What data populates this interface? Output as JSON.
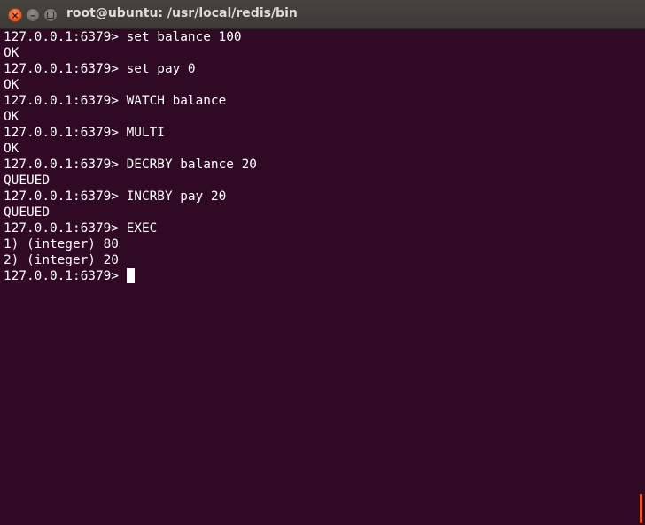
{
  "window": {
    "title": "root@ubuntu: /usr/local/redis/bin"
  },
  "terminal": {
    "prompt": "127.0.0.1:6379> ",
    "lines": [
      "127.0.0.1:6379> set balance 100",
      "OK",
      "127.0.0.1:6379> set pay 0",
      "OK",
      "127.0.0.1:6379> WATCH balance",
      "OK",
      "127.0.0.1:6379> MULTI",
      "OK",
      "127.0.0.1:6379> DECRBY balance 20",
      "QUEUED",
      "127.0.0.1:6379> INCRBY pay 20",
      "QUEUED",
      "127.0.0.1:6379> EXEC",
      "1) (integer) 80",
      "2) (integer) 20"
    ]
  },
  "icons": {
    "close": "close-icon",
    "minimize": "minimize-icon",
    "maximize": "maximize-icon"
  },
  "colors": {
    "terminal_bg": "#300a24",
    "titlebar_bg": "#3c3b37",
    "close_button": "#df4a16",
    "scroll_accent": "#e95420"
  }
}
